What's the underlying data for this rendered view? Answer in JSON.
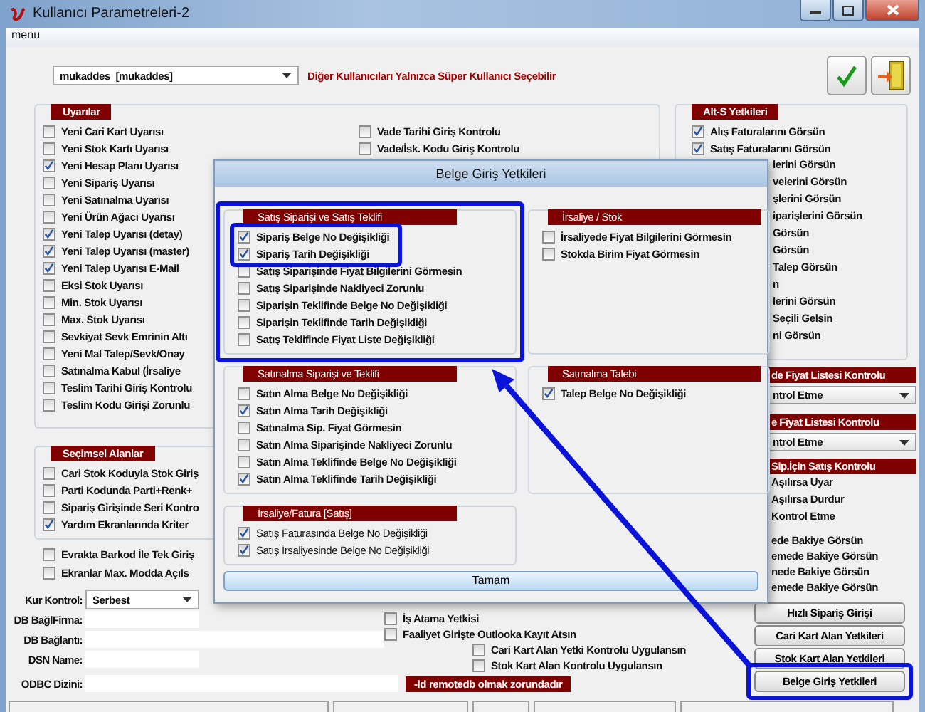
{
  "window": {
    "title": "Kullanıcı Parametreleri-2"
  },
  "menu": [
    "menu"
  ],
  "user_select": {
    "value": "mukaddes  [mukaddes]"
  },
  "user_note": "Diğer Kullanıcıları Yalnızca Süper Kullanıcı Seçebilir",
  "warnings": {
    "title": "Uyarılar",
    "items": [
      {
        "label": "Yeni Cari Kart Uyarısı",
        "checked": false
      },
      {
        "label": "Yeni Stok Kartı Uyarısı",
        "checked": false
      },
      {
        "label": "Yeni Hesap Planı Uyarısı",
        "checked": true
      },
      {
        "label": "Yeni Sipariş Uyarısı",
        "checked": false
      },
      {
        "label": "Yeni Satınalma Uyarısı",
        "checked": false
      },
      {
        "label": "Yeni Ürün Ağacı Uyarısı",
        "checked": false
      },
      {
        "label": "Yeni Talep Uyarısı (detay)",
        "checked": true
      },
      {
        "label": "Yeni Talep Uyarısı (master)",
        "checked": true
      },
      {
        "label": "Yeni Talep Uyarısı E-Mail",
        "checked": true
      },
      {
        "label": "Eksi Stok Uyarısı",
        "checked": false
      },
      {
        "label": "Min. Stok Uyarısı",
        "checked": false
      },
      {
        "label": "Max. Stok Uyarısı",
        "checked": false
      },
      {
        "label": "Sevkiyat Sevk Emrinin Altı",
        "checked": false
      },
      {
        "label": "Yeni Mal Talep/Sevk/Onay",
        "checked": false
      },
      {
        "label": "Satınalma Kabul (İrsaliye",
        "checked": false
      },
      {
        "label": "Teslim Tarihi Giriş Kontrolu",
        "checked": false
      },
      {
        "label": "Teslim Kodu Girişi Zorunlu",
        "checked": false
      }
    ],
    "items_column_2": [
      {
        "label": "Vade Tarihi Giriş Kontrolu",
        "checked": false
      },
      {
        "label": "Vade/İsk. Kodu Giriş Kontrolu",
        "checked": false
      }
    ]
  },
  "optional_fields": {
    "title": "Seçimsel Alanlar",
    "items": [
      {
        "label": "Cari Stok Koduyla Stok Giriş",
        "checked": false
      },
      {
        "label": "Parti Kodunda Parti+Renk+",
        "checked": false
      },
      {
        "label": "Sipariş Girişinde Seri Kontro",
        "checked": false
      },
      {
        "label": "Yardım Ekranlarında Kriter",
        "checked": true
      }
    ]
  },
  "extra_checks": [
    {
      "label": "Evrakta Barkod İle Tek Giriş",
      "checked": false
    },
    {
      "label": "Ekranlar Max. Modda Açıls",
      "checked": false
    }
  ],
  "currency_control": {
    "label": "Kur Kontrol:",
    "value": "Serbest"
  },
  "fields": [
    {
      "label": "DB BağlFirma:",
      "kind": "short"
    },
    {
      "label": "DB Bağlantı:",
      "kind": "long"
    },
    {
      "label": "DSN Name:",
      "kind": "short"
    }
  ],
  "odbc": {
    "label": "ODBC Dizini:",
    "note": "-ld remotedb olmak zorundadır"
  },
  "bottom_checks": [
    {
      "label": "İş Atama Yetkisi",
      "checked": false,
      "kind": "main"
    },
    {
      "label": "Faaliyet Girişte Outlooka Kayıt Atsın",
      "checked": false,
      "kind": "main"
    },
    {
      "label": "Cari Kart Alan Yetki Kontrolu Uygulansın",
      "checked": false,
      "kind": "indented"
    },
    {
      "label": "Stok Kart Alan Kontrolu Uygulansın",
      "checked": false,
      "kind": "indented"
    }
  ],
  "alt_s": {
    "title": "Alt-S Yetkileri",
    "items": [
      {
        "label": "Alış Faturalarını Görsün",
        "checked": true
      },
      {
        "label": "Satış Faturalarını Görsün",
        "checked": true
      }
    ],
    "partial_items": [
      "lerini Görsün",
      "velerini Görsün",
      "şlerini Görsün",
      "iparişlerini Görsün",
      "Görsün",
      "Görsün",
      "Talep Görsün",
      "n",
      "lerini Görsün",
      "Seçili Gelsin",
      "ni Görsün"
    ]
  },
  "price_checks": [
    {
      "title": "de Fiyat Listesi Kontrolu",
      "value": "ntrol Etme"
    },
    {
      "title": "e Fiyat Listesi Kontrolu",
      "value": "ntrol Etme"
    }
  ],
  "sales_control": {
    "title": "Sip.İçin Satış Kontrolu",
    "options": [
      "Aşılırsa Uyar",
      "Aşılırsa Durdur",
      "Kontrol Etme"
    ]
  },
  "balance_items": [
    "ede Bakiye Görsün",
    "emede Bakiye Görsün",
    "nede Bakiye Görsün",
    "emede Bakiye Görsün"
  ],
  "buttons": [
    "Hızlı Sipariş Girişi",
    "Cari Kart Alan Yetkileri",
    "Stok Kart Alan Yetkileri",
    "Belge Giriş Yetkileri"
  ],
  "dialog": {
    "title": "Belge Giriş Yetkileri",
    "ok": "Tamam",
    "groups": [
      {
        "title": "Satış Siparişi ve Satış Teklifi",
        "kind": "bold",
        "items": [
          {
            "label": "Sipariş Belge No Değişikliği",
            "checked": true
          },
          {
            "label": "Sipariş Tarih Değişikliği",
            "checked": true
          },
          {
            "label": "Satış Siparişinde Fiyat Bilgilerini Görmesin",
            "checked": false
          },
          {
            "label": "Satış Siparişinde Nakliyeci Zorunlu",
            "checked": false
          },
          {
            "label": "Siparişin Teklifinde Belge No Değişikliği",
            "checked": false
          },
          {
            "label": "Siparişin Teklifinde Tarih Değişikliği",
            "checked": false
          },
          {
            "label": "Satış Teklifinde Fiyat Liste Değişikliği",
            "checked": false
          }
        ]
      },
      {
        "title": "İrsaliye / Stok",
        "kind": "bold",
        "items": [
          {
            "label": "İrsaliyede Fiyat Bilgilerini Görmesin",
            "checked": false
          },
          {
            "label": "Stokda Birim Fiyat Görmesin",
            "checked": false
          }
        ]
      },
      {
        "title": "Satınalma Siparişi ve Teklifi",
        "kind": "bold",
        "items": [
          {
            "label": "Satın Alma Belge No Değişikliği",
            "checked": false
          },
          {
            "label": "Satın Alma Tarih Değişikliği",
            "checked": true
          },
          {
            "label": "Satınalma Sip. Fiyat Görmesin",
            "checked": false
          },
          {
            "label": "Satın Alma Siparişinde Nakliyeci Zorunlu",
            "checked": false
          },
          {
            "label": "Satın Alma Teklifinde Belge No Değişikliği",
            "checked": false
          },
          {
            "label": "Satın Alma Teklifinde Tarih Değişikliği",
            "checked": true
          }
        ]
      },
      {
        "title": "Satınalma Talebi",
        "kind": "bold",
        "items": [
          {
            "label": "Talep Belge No Değişikliği",
            "checked": true
          }
        ]
      },
      {
        "title": "İrsaliye/Fatura [Satış]",
        "kind": "plain",
        "items": [
          {
            "label": "Satış Faturasında Belge No Değişikliği",
            "checked": true
          },
          {
            "label": "Satış İrsaliyesinde Belge No Değişikliği",
            "checked": true
          }
        ]
      }
    ]
  }
}
